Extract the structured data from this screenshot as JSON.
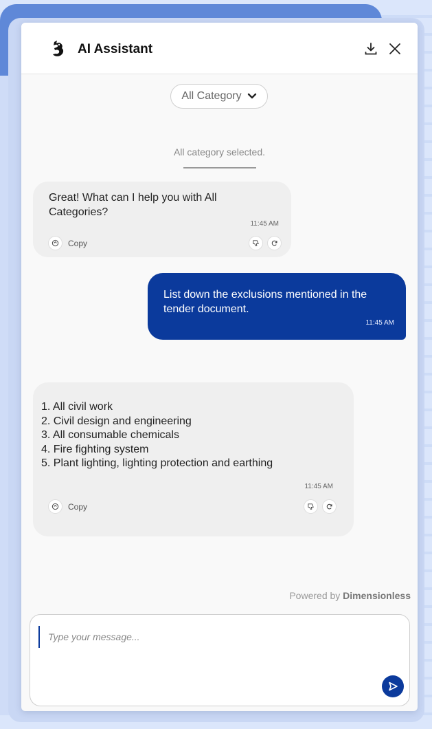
{
  "header": {
    "title": "AI Assistant",
    "logo_icon": "rooster-logo-icon",
    "download_icon": "download-icon",
    "close_icon": "close-icon"
  },
  "category": {
    "selected": "All Category",
    "icon": "chevron-down-icon"
  },
  "system_note": "All category selected.",
  "messages": [
    {
      "role": "assistant",
      "text_lines": [
        "Great! What can I help you with All",
        "Categories?"
      ],
      "time": "11:45 AM",
      "copy_label": "Copy"
    },
    {
      "role": "user",
      "text_lines": [
        "List down the exclusions mentioned in the",
        "tender document."
      ],
      "time": "11:45 AM"
    },
    {
      "role": "assistant",
      "text_lines": [
        "1. All civil work",
        "2. Civil design and engineering",
        "3. All consumable chemicals",
        "4. Fire fighting system",
        "5. Plant lighting, lighting protection and earthing"
      ],
      "time": "11:45 AM",
      "copy_label": "Copy"
    }
  ],
  "footer": {
    "powered_prefix": "Powered by",
    "powered_brand": "Dimensionless"
  },
  "composer": {
    "placeholder": "Type your message...",
    "value": "",
    "send_icon": "send-icon"
  },
  "colors": {
    "accent": "#0b3a9c",
    "bubble_bg": "#efefef",
    "panel_bg": "#f9f9f9"
  }
}
